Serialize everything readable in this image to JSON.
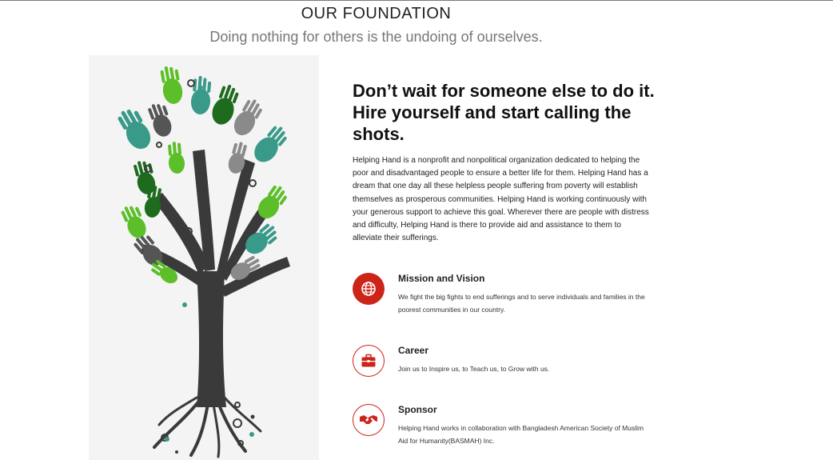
{
  "header": {
    "title": "OUR FOUNDATION",
    "subtitle": "Doing nothing for others is the undoing of ourselves."
  },
  "main": {
    "image": {
      "icon": "hands-tree-illustration"
    },
    "heading": "Don’t wait for someone else to do it. Hire yourself and start calling the shots.",
    "intro": "Helping Hand is a nonprofit and nonpolitical organization dedicated to helping the poor and disadvantaged people to ensure a better life for them. Helping Hand has a dream that one day all these helpless people suffering from poverty will establish themselves as prosperous communities. Helping Hand is working continuously with your generous support to achieve this goal. Wherever there are people with distress and difficulty, Helping Hand is there to provide aid and assistance to them to alleviate their sufferings.",
    "features": [
      {
        "icon": "globe-icon",
        "title": "Mission and Vision",
        "text": "We fight the big fights to end sufferings and to serve individuals and families in the poorest communities in our country."
      },
      {
        "icon": "briefcase-icon",
        "title": "Career",
        "text": "Join us to Inspire us, to Teach us, to Grow with us."
      },
      {
        "icon": "handshake-icon",
        "title": "Sponsor",
        "text": "Helping Hand works in collaboration with Bangladesh American Society of Muslim Aid for Humanity(BASMAH) Inc."
      }
    ]
  },
  "colors": {
    "accent": "#cc2419",
    "tree_trunk": "#3a3a3a",
    "leaf_green_dark": "#1e6b1e",
    "leaf_green_light": "#5cbf2a",
    "leaf_teal": "#3a9a8a",
    "leaf_gray": "#8a8a8a"
  }
}
